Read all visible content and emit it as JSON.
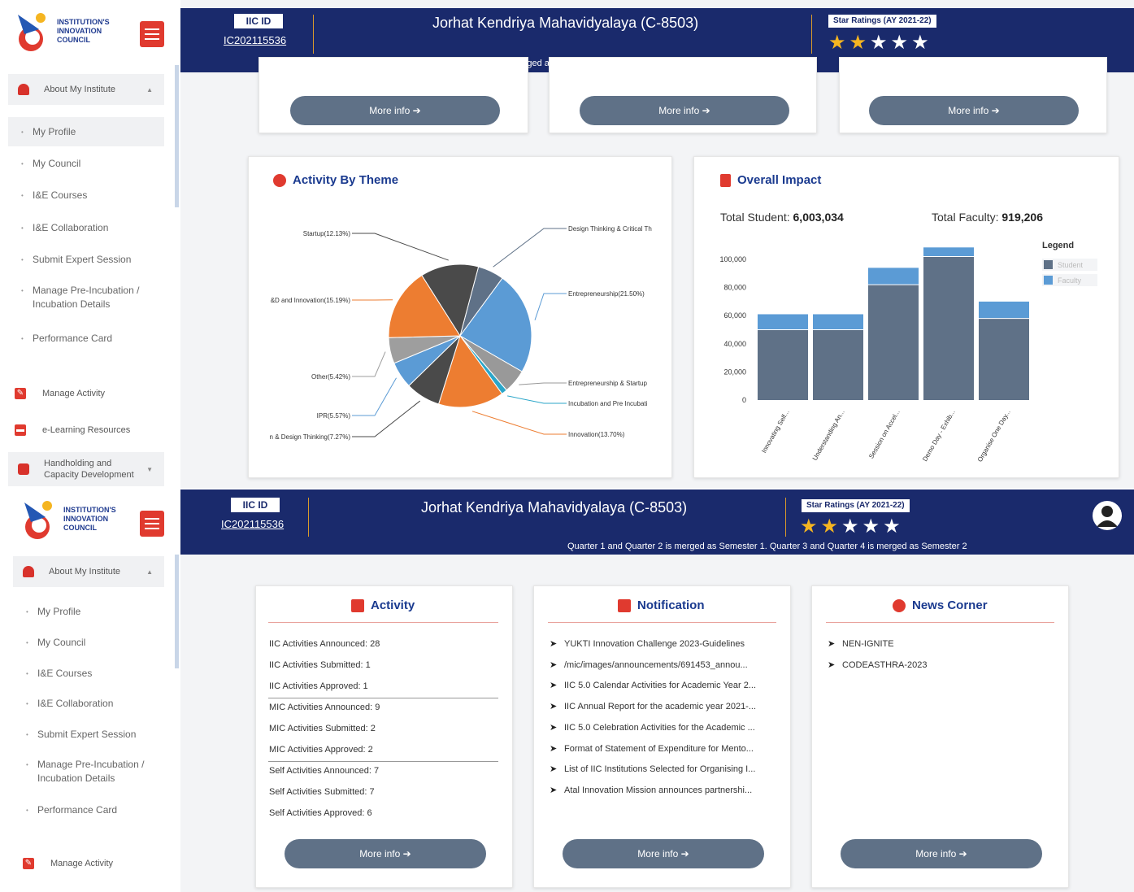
{
  "app": {
    "logo_text": "INSTITUTION'S\nINNOVATION\nCOUNCIL",
    "iic_label": "IIC ID",
    "iic_value": "IC202115536",
    "institute": "Jorhat Kendriya Mahavidyalaya (C-8503)",
    "star_label": "Star Ratings (AY 2021-22)",
    "stars_filled": 2,
    "stars_total": 5,
    "merge_note": "Quarter 1 and Quarter 2 is merged as Semester 1. Quarter 3 and Quarter 4 is merged as Semester 2"
  },
  "sidebar": {
    "about": "About My Institute",
    "items": [
      "My Profile",
      "My Council",
      "I&E Courses",
      "I&E Collaboration",
      "Submit Expert Session",
      "Manage Pre-Incubation / Incubation Details",
      "Performance Card"
    ],
    "manage_activity": "Manage Activity",
    "elearning": "e-Learning Resources",
    "handholding": "Handholding and Capacity Development"
  },
  "cards": {
    "more_info": "More info"
  },
  "activity_theme": {
    "title": "Activity By Theme"
  },
  "overall_impact": {
    "title": "Overall Impact",
    "total_student_label": "Total Student:",
    "total_student": "6,003,034",
    "total_faculty_label": "Total Faculty:",
    "total_faculty": "919,206",
    "legend_title": "Legend",
    "legend": [
      "Student",
      "Faculty"
    ]
  },
  "chart_data": [
    {
      "type": "pie",
      "title": "Activity By Theme",
      "labels": [
        "Design Thinking & Critical Th",
        "Entrepreneurship(21.50%)",
        "Entrepreneurship & Startup",
        "Incubation and Pre Incubati",
        "Innovation(13.70%)",
        "n & Design Thinking(7.27%)",
        "IPR(5.57%)",
        "Other(5.42%)",
        "&D and Innovation(15.19%)",
        "Startup(12.13%)"
      ],
      "values": [
        5.5,
        21.5,
        5.0,
        1.2,
        13.7,
        7.27,
        5.57,
        5.42,
        15.19,
        12.13
      ],
      "colors": [
        "#5f7187",
        "#5b9bd5",
        "#999999",
        "#2ba6c9",
        "#ed7d31",
        "#4a4a4a",
        "#5b9bd5",
        "#9e9e9e",
        "#ed7d31",
        "#4a4a4a"
      ]
    },
    {
      "type": "bar",
      "categories": [
        "Innovating Self...",
        "Understanding An...",
        "Session on Accel...",
        "Demo Day - Exhib...",
        "Organise One Day..."
      ],
      "series": [
        {
          "name": "Student",
          "values": [
            50000,
            50000,
            82000,
            102000,
            58000
          ]
        },
        {
          "name": "Faculty",
          "values": [
            11000,
            11000,
            12000,
            6500,
            12000
          ]
        }
      ],
      "ylim": [
        0,
        100000
      ],
      "yticks": [
        "0",
        "20,000",
        "40,000",
        "60,000",
        "80,000",
        "100,000"
      ],
      "colors": {
        "Student": "#5f7187",
        "Faculty": "#5b9bd5"
      },
      "legend": "right"
    }
  ],
  "activity": {
    "title": "Activity",
    "rows": [
      "IIC Activities Announced: 28",
      "IIC Activities Submitted: 1",
      "IIC Activities Approved: 1",
      "MIC Activities Announced: 9",
      "MIC Activities Submitted: 2",
      "MIC Activities Approved: 2",
      "Self Activities Announced: 7",
      "Self Activities Submitted: 7",
      "Self Activities Approved: 6"
    ]
  },
  "notification": {
    "title": "Notification",
    "items": [
      "YUKTI Innovation Challenge 2023-Guidelines",
      "/mic/images/announcements/691453_annou...",
      "IIC 5.0 Calendar Activities for Academic Year 2...",
      "IIC Annual Report for the academic year 2021-...",
      "IIC 5.0 Celebration Activities for the Academic ...",
      "Format of Statement of Expenditure for Mento...",
      "List of IIC Institutions Selected for Organising I...",
      "Atal Innovation Mission announces partnershi..."
    ]
  },
  "news": {
    "title": "News Corner",
    "items": [
      "NEN-IGNITE",
      "CODEASTHRA-2023"
    ]
  }
}
